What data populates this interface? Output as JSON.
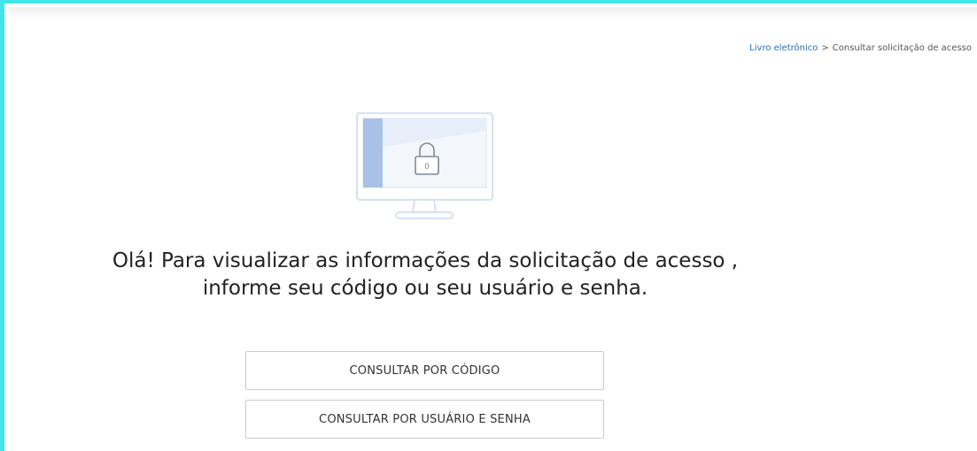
{
  "breadcrumb": {
    "items": [
      "Livro eletrônico",
      "Consultar solicitação de acesso"
    ],
    "separator": ">"
  },
  "illustration": {
    "icon": "monitor-lock-icon",
    "lock_label": "0"
  },
  "message": {
    "line1": "Olá! Para visualizar as informações da solicitação de acesso ,",
    "line2": "informe seu código ou seu usuário e senha."
  },
  "actions": {
    "by_code": "CONSULTAR POR CÓDIGO",
    "by_user": "CONSULTAR POR USUÁRIO E SENHA"
  },
  "colors": {
    "frame_accent": "#3ee6ea",
    "link": "#2a6fb0",
    "illustration_blue": "#a9c1e6",
    "button_border": "#c8ccd0"
  }
}
